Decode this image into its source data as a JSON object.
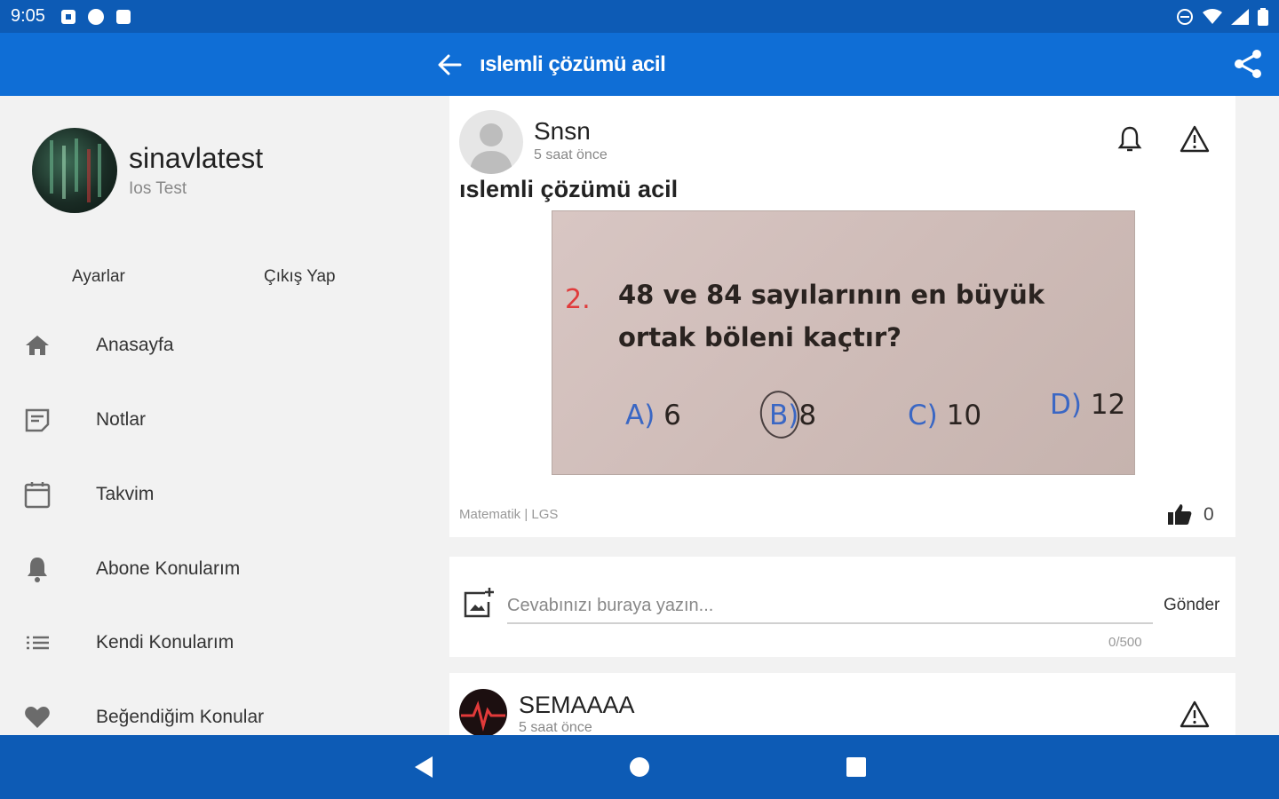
{
  "status_bar": {
    "time": "9:05"
  },
  "app_bar": {
    "title": "ıslemli çözümü acil"
  },
  "profile": {
    "name": "sinavlatest",
    "subtitle": "Ios Test"
  },
  "profile_actions": {
    "settings": "Ayarlar",
    "logout": "Çıkış Yap"
  },
  "nav": [
    {
      "label": "Anasayfa",
      "icon": "home-icon"
    },
    {
      "label": "Notlar",
      "icon": "notes-icon"
    },
    {
      "label": "Takvim",
      "icon": "calendar-icon"
    },
    {
      "label": "Abone Konularım",
      "icon": "bell-icon"
    },
    {
      "label": "Kendi Konularım",
      "icon": "list-icon"
    },
    {
      "label": "Beğendiğim Konular",
      "icon": "heart-icon"
    }
  ],
  "post": {
    "author": "Snsn",
    "time": "5 saat önce",
    "title": "ıslemli çözümü acil",
    "image": {
      "number": "2.",
      "question": "48 ve 84 sayılarının en büyük ortak böleni kaçtır?",
      "options": [
        {
          "key": "A)",
          "value": "6"
        },
        {
          "key": "B)",
          "value": "8"
        },
        {
          "key": "C)",
          "value": "10"
        },
        {
          "key": "D)",
          "value": "12"
        }
      ]
    },
    "tags": "Matematik | LGS",
    "likes": "0"
  },
  "reply": {
    "placeholder": "Cevabınızı buraya yazın...",
    "send": "Gönder",
    "counter": "0/500"
  },
  "comment": {
    "author": "SEMAAAA",
    "time": "5 saat önce"
  },
  "colors": {
    "primary": "#0f6ed6",
    "status_bar": "#0d5bb5"
  }
}
